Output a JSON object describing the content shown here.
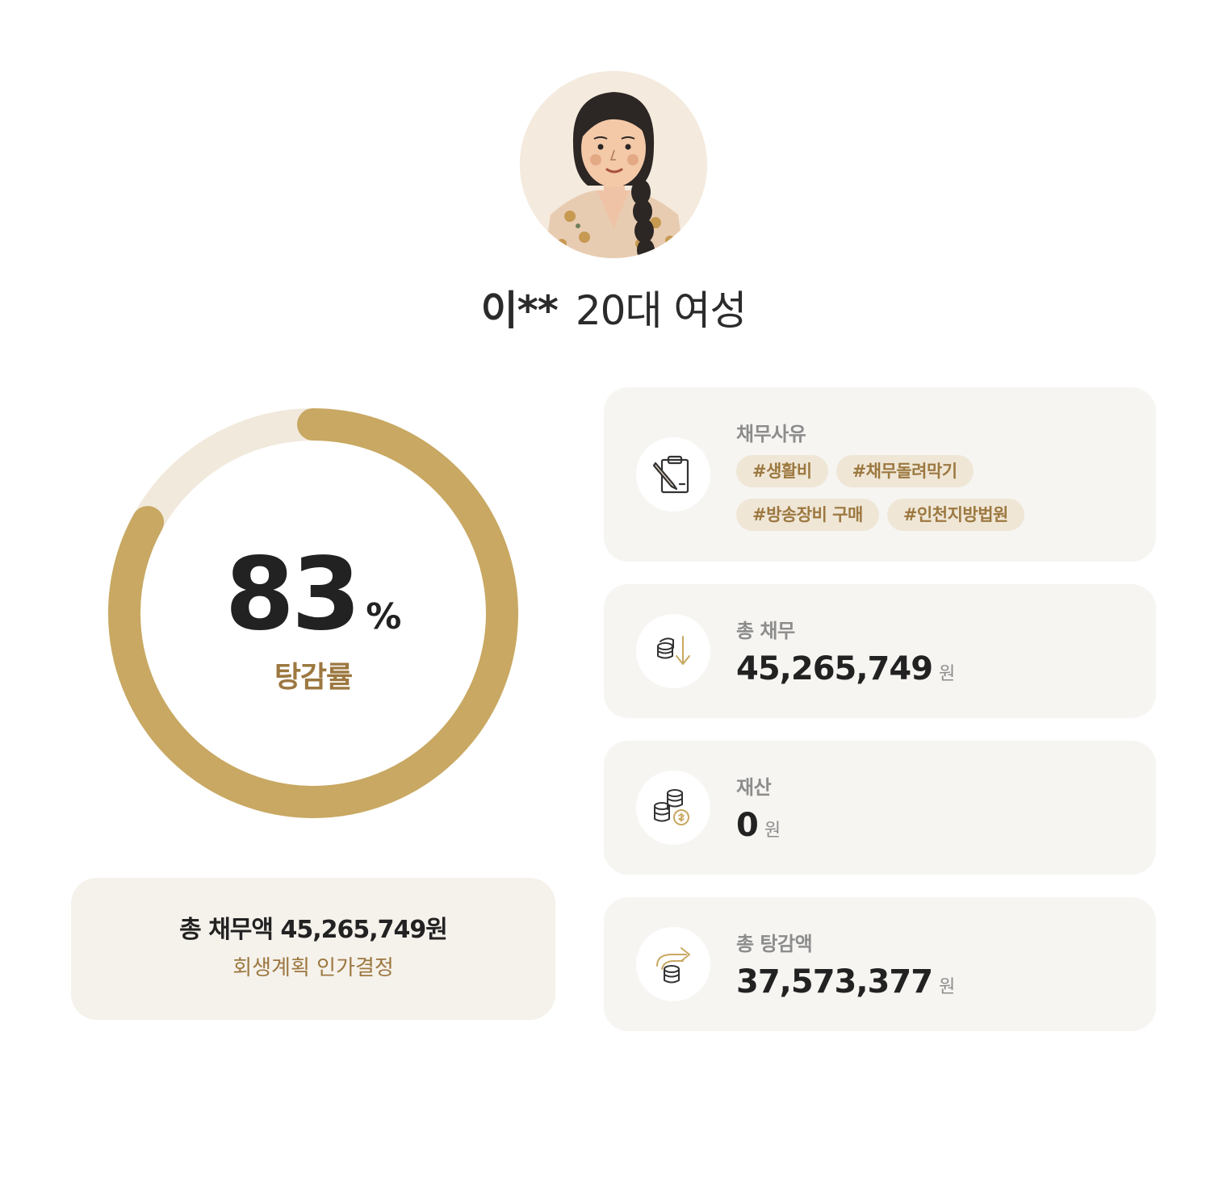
{
  "profile": {
    "avatar_alt": "woman-avatar",
    "masked_name": "이**",
    "demographic": "20대 여성"
  },
  "reduction": {
    "percent": 83,
    "percent_text": "83",
    "unit": "%",
    "label": "탕감률",
    "colors": {
      "filled": "#c8a862",
      "track": "#f1e9dc"
    }
  },
  "summary": {
    "total_debt_text": "총 채무액 45,265,749원",
    "status": "회생계획 인가결정"
  },
  "cards": {
    "reason": {
      "label": "채무사유",
      "icon": "clipboard-pen-icon",
      "tags": [
        "#생활비",
        "#채무돌려막기",
        "#방송장비 구매",
        "#인천지방법원"
      ]
    },
    "total_debt": {
      "label": "총 채무",
      "icon": "coins-down-icon",
      "value": "45,265,749",
      "unit": "원"
    },
    "assets": {
      "label": "재산",
      "icon": "coins-dollar-icon",
      "value": "0",
      "unit": "원"
    },
    "total_forgiven": {
      "label": "총 탕감액",
      "icon": "coins-arrow-icon",
      "value": "37,573,377",
      "unit": "원"
    }
  },
  "colors": {
    "accent": "#c8a862",
    "accent_text": "#9c7840",
    "card_bg": "#f6f5f2",
    "summary_bg": "#f5f1eb",
    "tag_bg": "#efe6d6"
  }
}
